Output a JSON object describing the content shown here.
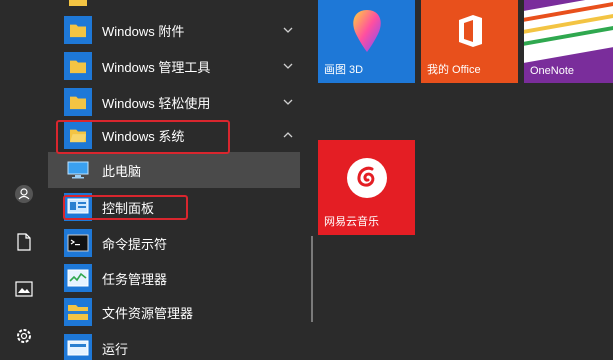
{
  "rail": {
    "items": [
      {
        "name": "user-icon"
      },
      {
        "name": "documents-icon"
      },
      {
        "name": "pictures-icon"
      },
      {
        "name": "settings-icon"
      }
    ]
  },
  "applist": {
    "items": [
      {
        "label": "Windows 附件",
        "icon": "folder-icon",
        "chevron": "down"
      },
      {
        "label": "Windows 管理工具",
        "icon": "folder-icon",
        "chevron": "down"
      },
      {
        "label": "Windows 轻松使用",
        "icon": "folder-icon",
        "chevron": "down"
      },
      {
        "label": "Windows 系统",
        "icon": "folder-open-icon",
        "chevron": "up"
      },
      {
        "label": "此电脑",
        "icon": "this-pc-icon"
      },
      {
        "label": "控制面板",
        "icon": "control-panel-icon"
      },
      {
        "label": "命令提示符",
        "icon": "command-prompt-icon"
      },
      {
        "label": "任务管理器",
        "icon": "task-manager-icon"
      },
      {
        "label": "文件资源管理器",
        "icon": "file-explorer-icon"
      },
      {
        "label": "运行",
        "icon": "run-icon"
      }
    ]
  },
  "tiles": {
    "paint3d": {
      "label": "画图 3D",
      "color": "#1e78d7"
    },
    "office": {
      "label": "我的 Office",
      "color": "#e8501c"
    },
    "onenote": {
      "label": "OneNote",
      "color": "#7a2d9b"
    },
    "netease": {
      "label": "网易云音乐",
      "color": "#e41e24"
    }
  },
  "colors": {
    "background": "#2b2b2b",
    "selected_row": "#4a4a4a",
    "highlight": "#d9262e",
    "folder": "#f3c443"
  }
}
